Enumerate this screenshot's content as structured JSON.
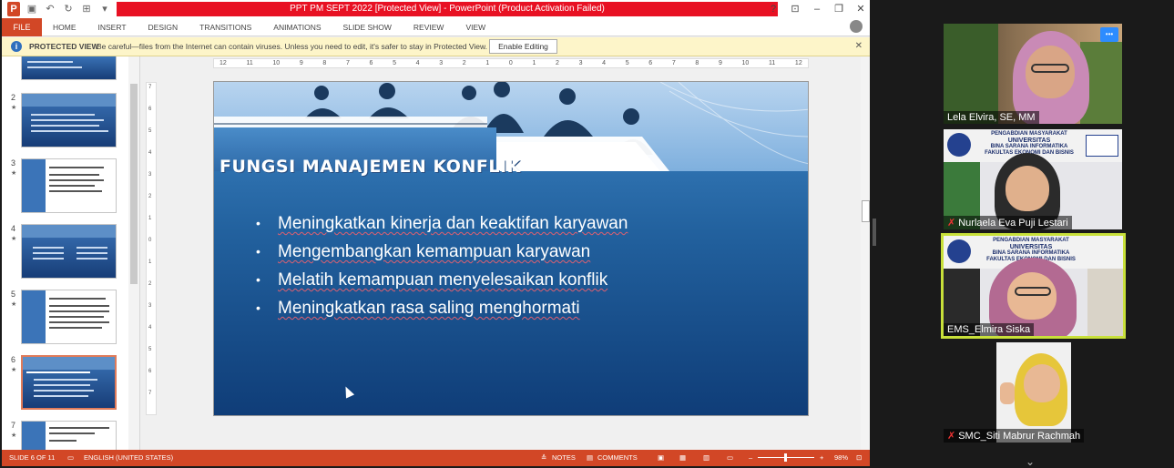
{
  "ppt": {
    "window_title": "PPT PM SEPT 2022 [Protected View] - PowerPoint (Product Activation Failed)",
    "ribbon_tabs": [
      "FILE",
      "HOME",
      "INSERT",
      "DESIGN",
      "TRANSITIONS",
      "ANIMATIONS",
      "SLIDE SHOW",
      "REVIEW",
      "VIEW"
    ],
    "protected_label": "PROTECTED VIEW",
    "protected_message": "Be careful—files from the Internet can contain viruses. Unless you need to edit, it's safer to stay in Protected View.",
    "enable_editing": "Enable Editing",
    "ruler_numbers": [
      "12",
      "11",
      "10",
      "9",
      "8",
      "7",
      "6",
      "5",
      "4",
      "3",
      "2",
      "1",
      "0",
      "1",
      "2",
      "3",
      "4",
      "5",
      "6",
      "7",
      "8",
      "9",
      "10",
      "11",
      "12"
    ],
    "vruler_numbers": [
      "7",
      "6",
      "5",
      "4",
      "3",
      "2",
      "1",
      "0",
      "1",
      "2",
      "3",
      "4",
      "5",
      "6",
      "7"
    ],
    "thumbnails": [
      {
        "num": "2",
        "star": "★"
      },
      {
        "num": "3",
        "star": "★"
      },
      {
        "num": "4",
        "star": "★"
      },
      {
        "num": "5",
        "star": "★"
      },
      {
        "num": "6",
        "star": "★",
        "selected": true
      },
      {
        "num": "7",
        "star": "★"
      }
    ],
    "slide": {
      "title": "FUNGSI MANAJEMEN KONFLIK",
      "bullets": [
        "Meningkatkan kinerja dan keaktifan karyawan",
        "Mengembangkan kemampuan karyawan",
        "Melatih kemampuan menyelesaikan konflik",
        "Meningkatkan rasa saling menghormati"
      ],
      "bullet_char": "•"
    },
    "status": {
      "slide_info": "SLIDE 6 OF 11",
      "language": "ENGLISH (UNITED STATES)",
      "notes": "NOTES",
      "comments": "COMMENTS",
      "zoom": "98%"
    }
  },
  "meeting": {
    "participants": [
      {
        "name": "Lela Elvira, SE, MM",
        "muted": false
      },
      {
        "name": "Nurlaela Eva Puji Lestari",
        "muted": true
      },
      {
        "name": "EMS_Elmira Siska",
        "muted": false,
        "active_speaker": true
      },
      {
        "name": "SMC_Siti Mabrur Rachmah",
        "muted": true
      }
    ],
    "more_button": "•••",
    "banner_text": {
      "line1": "PENGABDIAN MASYARAKAT",
      "line2": "UNIVERSITAS",
      "line3": "BINA SARANA INFORMATIKA",
      "line4": "FAKULTAS EKONOMI DAN BISNIS"
    }
  },
  "colors": {
    "ppt_accent": "#d24726",
    "active_speaker_border": "#c8e03a",
    "title_bar_alert": "#e81123"
  }
}
